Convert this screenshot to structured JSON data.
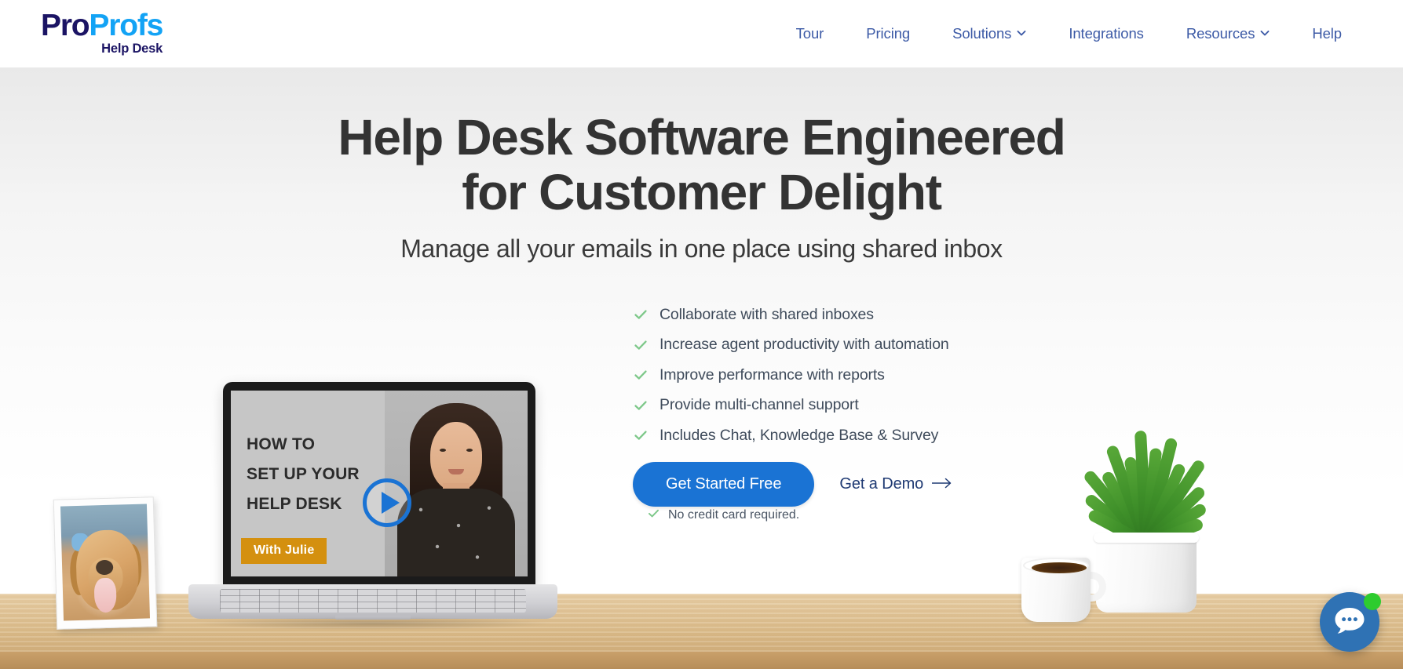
{
  "brand": {
    "logo_pro": "Pro",
    "logo_profs": "Profs",
    "logo_sub": "Help Desk",
    "color_navy": "#1b1464",
    "color_cyan": "#13a3f5",
    "color_primary": "#1a73d4"
  },
  "nav": {
    "items": [
      {
        "label": "Tour",
        "has_caret": false
      },
      {
        "label": "Pricing",
        "has_caret": false
      },
      {
        "label": "Solutions",
        "has_caret": true
      },
      {
        "label": "Integrations",
        "has_caret": false
      },
      {
        "label": "Resources",
        "has_caret": true
      },
      {
        "label": "Help",
        "has_caret": false
      }
    ]
  },
  "hero": {
    "headline_line1": "Help Desk Software Engineered",
    "headline_line2": "for Customer Delight",
    "subheadline": "Manage all your emails in one place using shared inbox",
    "features": [
      "Collaborate with shared inboxes",
      "Increase agent productivity with automation",
      "Improve performance with reports",
      "Provide multi-channel support",
      "Includes Chat, Knowledge Base & Survey"
    ],
    "cta_primary": "Get Started Free",
    "cta_secondary": "Get a Demo",
    "cta_secondary_arrow": "→",
    "no_credit_card": "No credit card required."
  },
  "video": {
    "title_line1": "HOW TO",
    "title_line2": "SET UP YOUR",
    "title_line3": "HELP DESK",
    "presenter_badge": "With Julie",
    "badge_color": "#d4900f"
  },
  "chat": {
    "status_color": "#2ecc2e",
    "bubble_color": "#2f72b4"
  }
}
